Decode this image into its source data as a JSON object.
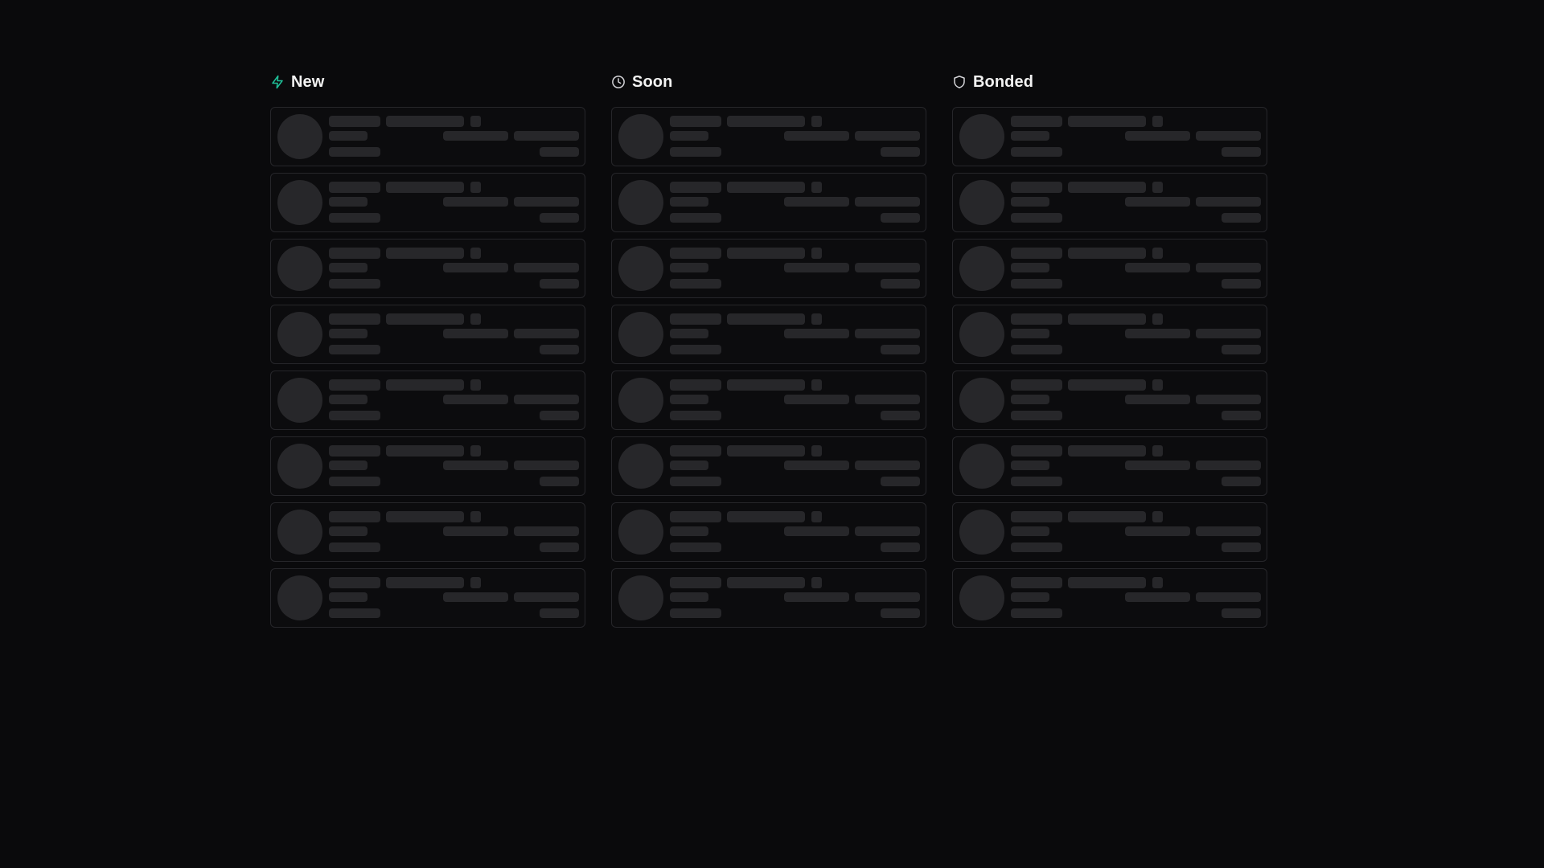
{
  "columns": [
    {
      "id": "new",
      "title": "New",
      "icon": "lightning-icon",
      "icon_color": "#1fbf98",
      "card_count": 8
    },
    {
      "id": "soon",
      "title": "Soon",
      "icon": "clock-icon",
      "icon_color": "#d4d4d8",
      "card_count": 8
    },
    {
      "id": "bonded",
      "title": "Bonded",
      "icon": "shield-icon",
      "icon_color": "#d4d4d8",
      "card_count": 8
    }
  ],
  "colors": {
    "background": "#0a0a0c",
    "card_border": "#26262a",
    "skeleton": "#27272a"
  }
}
